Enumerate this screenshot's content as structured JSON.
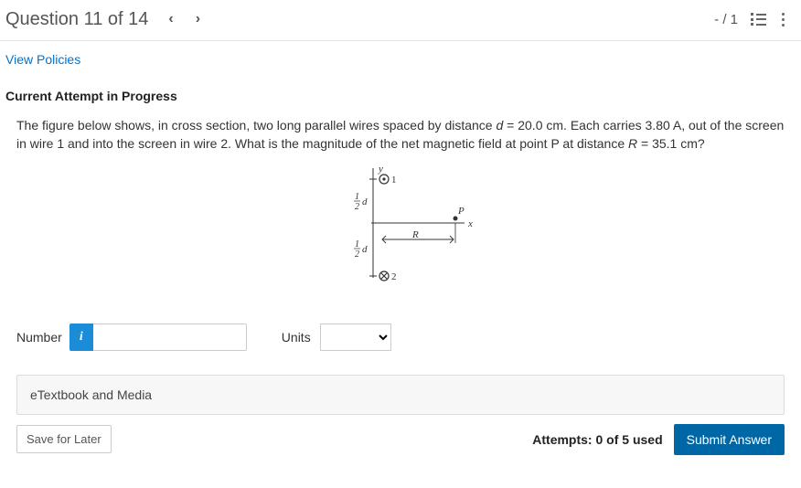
{
  "header": {
    "title": "Question 11 of 14",
    "score": "- / 1"
  },
  "policies_link": "View Policies",
  "attempt_header": "Current Attempt in Progress",
  "question": {
    "text_html": "The figure below shows, in cross section, two long parallel wires spaced by distance <i>d</i> = 20.0 cm. Each carries 3.80 A, out of the screen in wire 1 and into the screen in wire 2. What is the magnitude of the net magnetic field at point P at distance <i>R</i> = 35.1 cm?"
  },
  "figure": {
    "y_label": "y",
    "x_label": "x",
    "wire1_label": "1",
    "wire2_label": "2",
    "P_label": "P",
    "R_label": "R",
    "half_d_top": "½d",
    "half_d_bot": "½d"
  },
  "inputs": {
    "number_label": "Number",
    "info_badge": "i",
    "number_value": "",
    "units_label": "Units",
    "units_value": ""
  },
  "etextbook": "eTextbook and Media",
  "footer": {
    "save_label": "Save for Later",
    "attempts": "Attempts: 0 of 5 used",
    "submit_label": "Submit Answer"
  }
}
